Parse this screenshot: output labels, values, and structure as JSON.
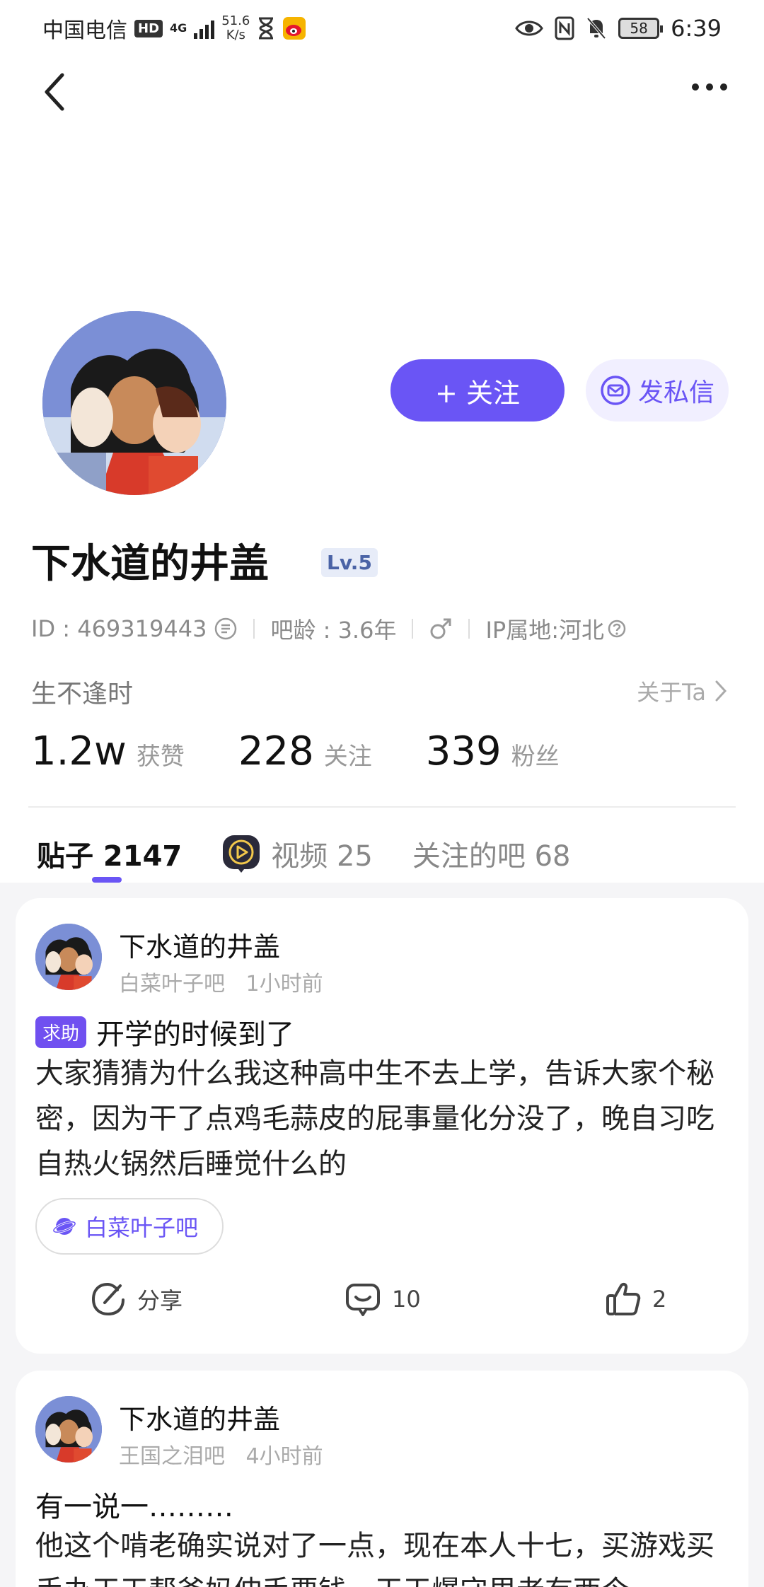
{
  "status_bar": {
    "carrier": "中国电信",
    "hd": "HD",
    "network": "4G",
    "speed_value": "51.6",
    "speed_unit": "K/s",
    "battery": "58",
    "time": "6:39"
  },
  "header": {
    "back_icon": "chevron-left-icon",
    "more_icon": "more-dots-icon"
  },
  "profile": {
    "follow_label": "+ 关注",
    "message_label": "发私信",
    "username": "下水道的井盖",
    "level": "Lv.5",
    "id_text": "ID : 469319443",
    "age_text": "吧龄 : 3.6年",
    "gender_icon": "male-icon",
    "ip_text": "IP属地:河北",
    "bio": "生不逢时",
    "about_label": "关于Ta",
    "stats": [
      {
        "num": "1.2w",
        "label": "获赞"
      },
      {
        "num": "228",
        "label": "关注"
      },
      {
        "num": "339",
        "label": "粉丝"
      }
    ]
  },
  "tabs": [
    {
      "label": "贴子 2147",
      "active": true
    },
    {
      "label": "视频 25",
      "active": false
    },
    {
      "label": "关注的吧 68",
      "active": false
    }
  ],
  "posts": [
    {
      "author": "下水道的井盖",
      "forum": "白菜叶子吧",
      "time": "1小时前",
      "tag": "求助",
      "title": "开学的时候到了",
      "body": "大家猜猜为什么我这种高中生不去上学，告诉大家个秘密，因为干了点鸡毛蒜皮的屁事量化分没了，晚自习吃自热火锅然后睡觉什么的",
      "forum_pill": "白菜叶子吧",
      "share_label": "分享",
      "comments": "10",
      "likes": "2"
    },
    {
      "author": "下水道的井盖",
      "forum": "王国之泪吧",
      "time": "4小时前",
      "title": "有一说一………",
      "body": "他这个啃老确实说对了一点，现在本人十七，买游戏买手办天天帮爸妈伸手要钱，天天爆守里老有西今"
    }
  ],
  "colors": {
    "accent": "#6a55f5",
    "accent_light": "#f1efff",
    "feed_bg": "#f5f5f7"
  }
}
